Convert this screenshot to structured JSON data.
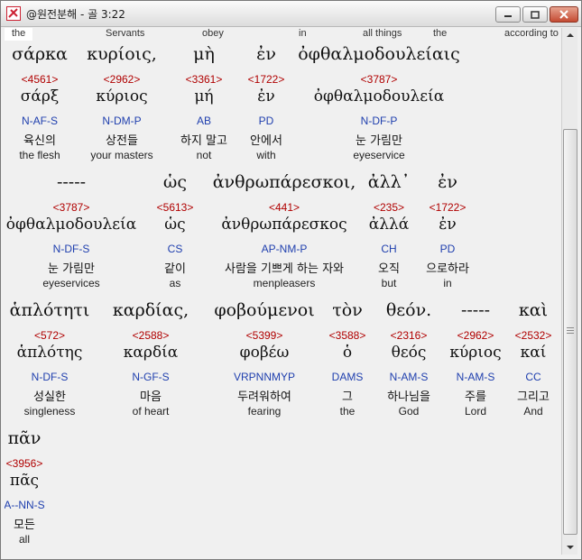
{
  "window": {
    "title": "@원전분해 - 골 3:22"
  },
  "topline": [
    "the",
    "Servants",
    "obey",
    "in",
    "all things",
    "the",
    "according to"
  ],
  "rows": [
    {
      "words": [
        {
          "greek": "σάρκα",
          "strong": "<4561>",
          "lemma": "σάρξ",
          "parse": "N-AF-S",
          "korean": "육신의",
          "english": "the flesh"
        },
        {
          "greek": "κυρίοις,",
          "strong": "<2962>",
          "lemma": "κύριος",
          "parse": "N-DM-P",
          "korean": "상전들",
          "english": "your masters"
        },
        {
          "greek": "μὴ",
          "strong": "<3361>",
          "lemma": "μή",
          "parse": "AB",
          "korean": "하지 말고",
          "english": "not"
        },
        {
          "greek": "ἐν",
          "strong": "<1722>",
          "lemma": "ἐν",
          "parse": "PD",
          "korean": "안에서",
          "english": "with"
        },
        {
          "greek": "ὀφθαλμοδουλείαις",
          "strong": "<3787>",
          "lemma": "ὀφθαλμοδουλεία",
          "parse": "N-DF-P",
          "korean": "눈 가림만",
          "english": "eyeservice"
        }
      ]
    },
    {
      "words": [
        {
          "greek": "-----",
          "strong": "<3787>",
          "lemma": "ὀφθαλμοδουλεία",
          "parse": "N-DF-S",
          "korean": "눈 가림만",
          "english": "eyeservices"
        },
        {
          "greek": "ὡς",
          "strong": "<5613>",
          "lemma": "ὡς",
          "parse": "CS",
          "korean": "같이",
          "english": "as"
        },
        {
          "greek": "ἀνθρωπάρεσκοι,",
          "strong": "<441>",
          "lemma": "ἀνθρωπάρεσκος",
          "parse": "AP-NM-P",
          "korean": "사람을 기쁘게 하는 자와",
          "english": "menpleasers"
        },
        {
          "greek": "ἀλλ᾽",
          "strong": "<235>",
          "lemma": "ἀλλά",
          "parse": "CH",
          "korean": "오직",
          "english": "but"
        },
        {
          "greek": "ἐν",
          "strong": "<1722>",
          "lemma": "ἐν",
          "parse": "PD",
          "korean": "으로하라",
          "english": "in"
        }
      ]
    },
    {
      "words": [
        {
          "greek": "ἁπλότητι",
          "strong": "<572>",
          "lemma": "ἁπλότης",
          "parse": "N-DF-S",
          "korean": "성실한",
          "english": "singleness"
        },
        {
          "greek": "καρδίας,",
          "strong": "<2588>",
          "lemma": "καρδία",
          "parse": "N-GF-S",
          "korean": "마음",
          "english": "of heart"
        },
        {
          "greek": "φοβούμενοι",
          "strong": "<5399>",
          "lemma": "φοβέω",
          "parse": "VRPNNMYP",
          "korean": "두려워하여",
          "english": "fearing"
        },
        {
          "greek": "τὸν",
          "strong": "<3588>",
          "lemma": "ὁ",
          "parse": "DAMS",
          "korean": "그",
          "english": "the"
        },
        {
          "greek": "θεόν.",
          "strong": "<2316>",
          "lemma": "θεός",
          "parse": "N-AM-S",
          "korean": "하나님을",
          "english": "God"
        },
        {
          "greek": "-----",
          "strong": "<2962>",
          "lemma": "κύριος",
          "parse": "N-AM-S",
          "korean": "주를",
          "english": "Lord"
        },
        {
          "greek": "καὶ",
          "strong": "<2532>",
          "lemma": "καί",
          "parse": "CC",
          "korean": "그리고",
          "english": "And"
        }
      ]
    },
    {
      "words": [
        {
          "greek": "πᾶν",
          "strong": "<3956>",
          "lemma": "πᾶς",
          "parse": "A--NN-S",
          "korean": "모든",
          "english": "all"
        }
      ]
    }
  ]
}
